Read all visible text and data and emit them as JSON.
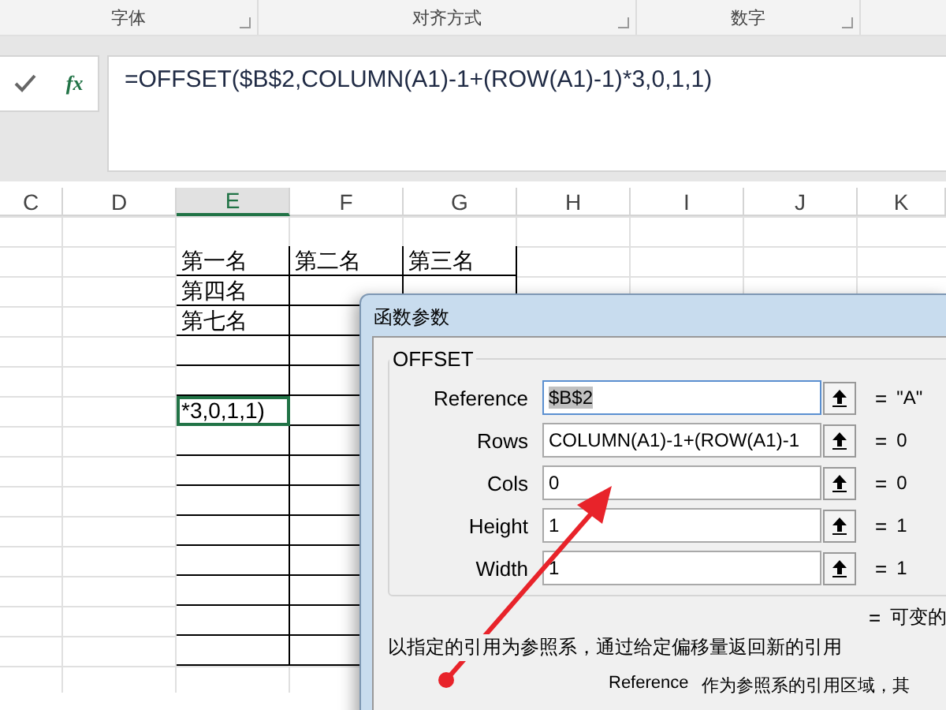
{
  "ribbon": {
    "groups": [
      "字体",
      "对齐方式",
      "数字"
    ]
  },
  "formula_bar": {
    "function_button": "fx",
    "formula": "=OFFSET($B$2,COLUMN(A1)-1+(ROW(A1)-1)*3,0,1,1)"
  },
  "sheet": {
    "columns": [
      {
        "label": "C",
        "selected": false
      },
      {
        "label": "D",
        "selected": false
      },
      {
        "label": "E",
        "selected": true
      },
      {
        "label": "F",
        "selected": false
      },
      {
        "label": "G",
        "selected": false
      },
      {
        "label": "H",
        "selected": false
      },
      {
        "label": "I",
        "selected": false
      },
      {
        "label": "J",
        "selected": false
      },
      {
        "label": "K",
        "selected": false
      }
    ]
  },
  "table": {
    "rows": [
      [
        {
          "text": "第一名",
          "selected": false
        },
        {
          "text": "第二名",
          "selected": false
        },
        {
          "text": "第三名",
          "selected": false
        }
      ],
      [
        {
          "text": "第四名",
          "selected": false
        },
        {
          "selected": false
        },
        {
          "selected": false
        }
      ],
      [
        {
          "text": "第七名",
          "selected": false
        },
        {
          "selected": false
        }
      ],
      [
        {
          "selected": false
        },
        {
          "selected": false
        }
      ],
      [
        {
          "selected": false
        },
        {
          "selected": false
        }
      ],
      [
        {
          "text": "*3,0,1,1)",
          "selected": true
        },
        {
          "selected": false
        }
      ],
      [
        {
          "selected": false
        },
        {
          "selected": false
        }
      ],
      [
        {
          "selected": false
        },
        {
          "selected": false
        }
      ],
      [
        {
          "selected": false
        },
        {
          "selected": false
        }
      ],
      [
        {
          "selected": false
        },
        {
          "selected": false
        }
      ],
      [
        {
          "selected": false
        },
        {
          "selected": false
        }
      ],
      [
        {
          "selected": false
        },
        {
          "selected": false
        }
      ],
      [
        {
          "selected": false
        },
        {
          "selected": false
        }
      ],
      [
        {
          "selected": false
        },
        {
          "selected": false
        }
      ]
    ]
  },
  "dialog": {
    "title": "函数参数",
    "function": "OFFSET",
    "arguments": [
      {
        "name": "Reference",
        "value": "$B$2",
        "highlighted": true,
        "equals": "=",
        "result": "\"A\""
      },
      {
        "name": "Rows",
        "value": "COLUMN(A1)-1+(ROW(A1)-1",
        "highlighted": false,
        "equals": "=",
        "result": "0"
      },
      {
        "name": "Cols",
        "value": "0",
        "highlighted": false,
        "equals": "=",
        "result": "0"
      },
      {
        "name": "Height",
        "value": "1",
        "highlighted": false,
        "equals": "=",
        "result": "1"
      },
      {
        "name": "Width",
        "value": "1",
        "highlighted": false,
        "equals": "=",
        "result": "1"
      }
    ],
    "result_equals": "=",
    "result": "可变的",
    "description": "以指定的引用为参照系，通过给定偏移量返回新的引用",
    "help_name": "Reference",
    "help_text": "作为参照系的引用区域，其"
  }
}
